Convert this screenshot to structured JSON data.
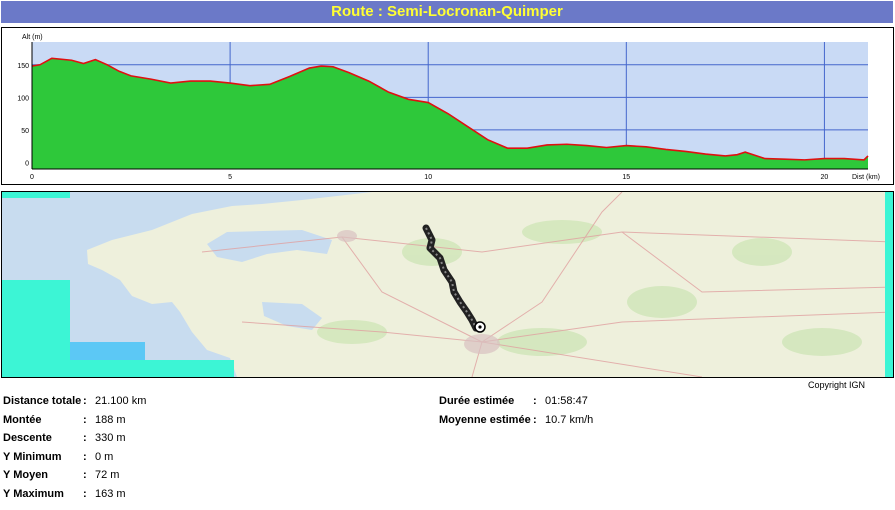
{
  "header": {
    "title": "Route : Semi-Locronan-Quimper"
  },
  "chart_data": {
    "type": "area",
    "ylabel": "Alt (m)",
    "xlabel": "Dist (km)",
    "xlim": [
      0,
      21.1
    ],
    "ylim": [
      -10,
      185
    ],
    "x_ticks": [
      "0",
      "5",
      "10",
      "15",
      "20"
    ],
    "y_ticks": [
      "0",
      "50",
      "100",
      "150"
    ],
    "grid": true,
    "fill_color": "#2ec83a",
    "line_color": "#e01010",
    "background_color": "#c9daf5",
    "x": [
      0,
      0.2,
      0.5,
      1.0,
      1.3,
      1.6,
      1.9,
      2.2,
      2.5,
      3.0,
      3.5,
      4.0,
      4.5,
      5.0,
      5.5,
      6.0,
      6.5,
      7.0,
      7.3,
      7.6,
      8.0,
      8.5,
      9.0,
      9.5,
      10.0,
      10.5,
      11.0,
      11.5,
      12.0,
      12.5,
      13.0,
      13.5,
      14.0,
      14.5,
      15.0,
      15.5,
      16.0,
      16.5,
      17.0,
      17.5,
      17.8,
      18.0,
      18.5,
      19.0,
      19.5,
      20.0,
      20.5,
      21.0,
      21.1
    ],
    "y": [
      148,
      150,
      160,
      157,
      152,
      158,
      150,
      140,
      133,
      128,
      122,
      125,
      125,
      122,
      118,
      120,
      132,
      145,
      148,
      147,
      138,
      125,
      108,
      97,
      92,
      75,
      55,
      35,
      22,
      22,
      27,
      28,
      26,
      23,
      26,
      24,
      20,
      17,
      13,
      10,
      12,
      16,
      6,
      5,
      4,
      6,
      6,
      4,
      10
    ],
    "route_summary": "Locronan - Quimper"
  },
  "map": {
    "copyright": "Copyright IGN",
    "start_marker": "start-point-icon"
  },
  "stats": {
    "distance": {
      "label": "Distance totale",
      "value": "21.100 km"
    },
    "montee": {
      "label": "Montée",
      "value": "188 m"
    },
    "descente": {
      "label": "Descente",
      "value": "330 m"
    },
    "ymin": {
      "label": "Y Minimum",
      "value": "0 m"
    },
    "ymoyen": {
      "label": "Y Moyen",
      "value": "72 m"
    },
    "ymax": {
      "label": "Y Maximum",
      "value": "163 m"
    },
    "duree": {
      "label": "Durée estimée",
      "value": "01:58:47"
    },
    "moyenne": {
      "label": "Moyenne estimée",
      "value": "10.7 km/h"
    },
    "colon": ":"
  }
}
